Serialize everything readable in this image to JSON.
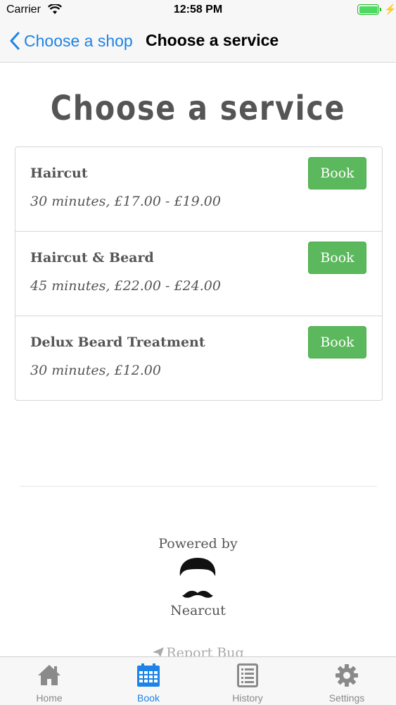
{
  "status_bar": {
    "carrier": "Carrier",
    "time": "12:58 PM",
    "battery_level": 1.0,
    "charging": true
  },
  "nav": {
    "back_label": "Choose a shop",
    "title": "Choose a service"
  },
  "heading": "Choose a service",
  "services": [
    {
      "name": "Haircut",
      "details": "30 minutes, £17.00 - £19.00",
      "book_label": "Book"
    },
    {
      "name": "Haircut & Beard",
      "details": "45 minutes, £22.00 - £24.00",
      "book_label": "Book"
    },
    {
      "name": "Delux Beard Treatment",
      "details": "30 minutes, £12.00",
      "book_label": "Book"
    }
  ],
  "footer": {
    "powered_by": "Powered by",
    "brand": "Nearcut",
    "report_bug": "Report Bug"
  },
  "tabs": [
    {
      "label": "Home",
      "icon": "home-icon",
      "active": false
    },
    {
      "label": "Book",
      "icon": "calendar-icon",
      "active": true
    },
    {
      "label": "History",
      "icon": "list-icon",
      "active": false
    },
    {
      "label": "Settings",
      "icon": "gear-icon",
      "active": false
    }
  ],
  "colors": {
    "accent": "#1e83e6",
    "book_button": "#5cb85c",
    "battery": "#4cd964"
  }
}
